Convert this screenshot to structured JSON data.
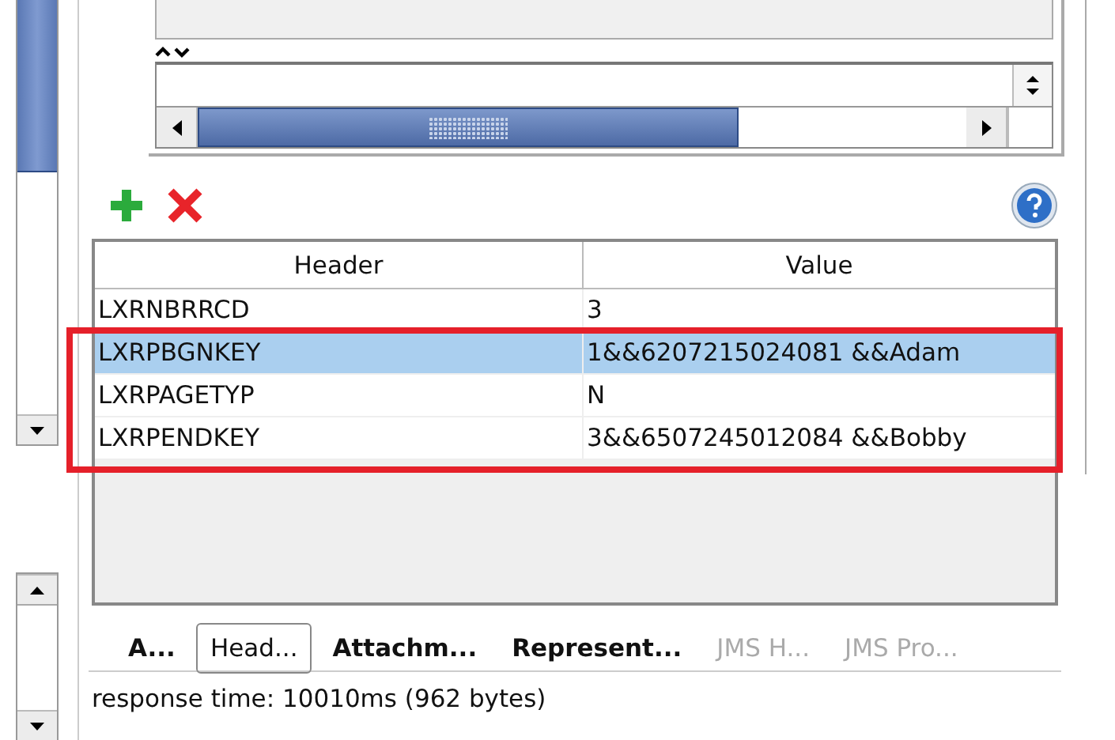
{
  "table": {
    "columns": [
      "Header",
      "Value"
    ],
    "rows": [
      {
        "header": "LXRNBRRCD",
        "value": "3",
        "selected": false
      },
      {
        "header": "LXRPBGNKEY",
        "value": "1&&6207215024081  &&Adam",
        "selected": true
      },
      {
        "header": "LXRPAGETYP",
        "value": "N",
        "selected": false
      },
      {
        "header": "LXRPENDKEY",
        "value": "3&&6507245012084  &&Bobby",
        "selected": false
      }
    ]
  },
  "tabs": [
    {
      "label": "A...",
      "selected": false,
      "disabled": false
    },
    {
      "label": "Head...",
      "selected": true,
      "disabled": false
    },
    {
      "label": "Attachm...",
      "selected": false,
      "disabled": false
    },
    {
      "label": "Represent...",
      "selected": false,
      "disabled": false
    },
    {
      "label": "JMS H...",
      "selected": false,
      "disabled": true
    },
    {
      "label": "JMS Pro...",
      "selected": false,
      "disabled": true
    }
  ],
  "status_bar": "response time: 10010ms (962 bytes)"
}
